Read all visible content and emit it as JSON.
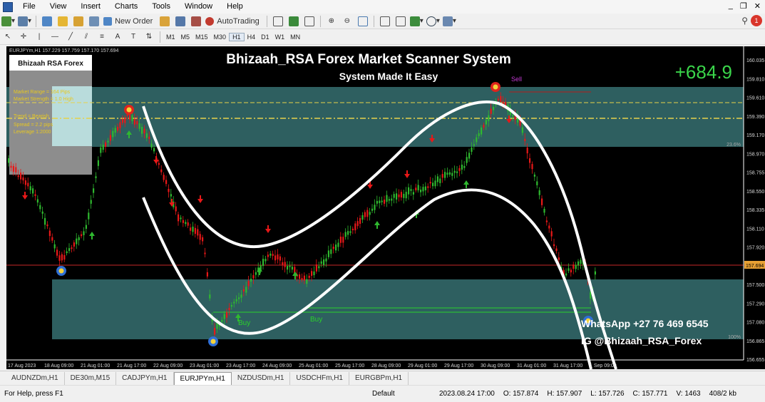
{
  "menu": [
    "File",
    "View",
    "Insert",
    "Charts",
    "Tools",
    "Window",
    "Help"
  ],
  "toolbar": {
    "new_order": "New Order",
    "autotrading": "AutoTrading"
  },
  "timeframes": [
    "M1",
    "M5",
    "M15",
    "M30",
    "H1",
    "H4",
    "D1",
    "W1",
    "MN"
  ],
  "active_timeframe": "H1",
  "chart": {
    "symbol_info": "EURJPYm,H1  157.229 157.759 157.170 157.694",
    "title": "Bhizaah_RSA Forex Market Scanner System",
    "subtitle": "System Made It Easy",
    "profit": "+684.9",
    "panel_title": "Bhizaah RSA Forex",
    "panel_lines": [
      "Market Range = 164 Pips",
      "Market Strength = 1.0 High",
      "Trend = Bearish",
      "Spread = 2.2 pips",
      "Leverage 1:2000"
    ],
    "sell_label": "Sell",
    "buy_label_1": "Buy",
    "buy_label_2": "Buy",
    "fib_top": "23.6%",
    "fib_bottom": "100%",
    "whatsapp": "WhatsApp +27 76 469 6545",
    "ig": "IG @Bhizaah_RSA_Forex",
    "price_labels": [
      "160.035",
      "159.810",
      "159.610",
      "159.390",
      "159.170",
      "158.970",
      "158.755",
      "158.550",
      "158.335",
      "158.110",
      "157.920",
      "157.694",
      "157.500",
      "157.290",
      "157.080",
      "156.865",
      "156.655"
    ],
    "current_price": "157.694",
    "time_labels": [
      "17 Aug 2023",
      "18 Aug 09:00",
      "21 Aug 01:00",
      "21 Aug 17:00",
      "22 Aug 09:00",
      "23 Aug 01:00",
      "23 Aug 17:00",
      "24 Aug 09:00",
      "25 Aug 01:00",
      "25 Aug 17:00",
      "28 Aug 09:00",
      "29 Aug 01:00",
      "29 Aug 17:00",
      "30 Aug 09:00",
      "31 Aug 01:00",
      "31 Aug 17:00",
      "1 Sep 09:00"
    ],
    "colors": {
      "bull": "#2fb92f",
      "bear": "#e81818",
      "zone": "#2e5f60",
      "price_line": "#c62828"
    }
  },
  "tabs": [
    "AUDNZDm,H1",
    "DE30m,M15",
    "CADJPYm,H1",
    "EURJPYm,H1",
    "NZDUSDm,H1",
    "USDCHFm,H1",
    "EURGBPm,H1"
  ],
  "active_tab": "EURJPYm,H1",
  "status": {
    "help": "For Help, press F1",
    "profile": "Default",
    "datetime": "2023.08.24 17:00",
    "open": "O: 157.874",
    "high": "H: 157.907",
    "low": "L: 157.726",
    "close": "C: 157.771",
    "volume": "V: 1463",
    "traffic": "408/2 kb"
  }
}
